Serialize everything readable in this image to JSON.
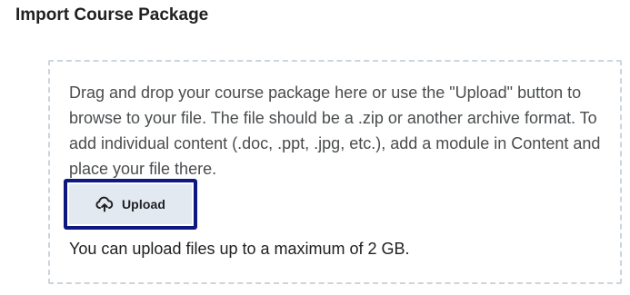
{
  "header": {
    "title": "Import Course Package"
  },
  "dropzone": {
    "instructions": "Drag and drop your course package here or use the \"Upload\" button to browse to your file. The file should be a .zip or another archive format. To add individual content (.doc, .ppt, .jpg, etc.), add a module in Content and place your file there.",
    "upload_button": {
      "label": "Upload",
      "icon": "cloud-upload-icon"
    },
    "limit_text": "You can upload files up to a maximum of 2 GB."
  },
  "colors": {
    "focus_border": "#0d1880",
    "button_bg": "#e3e9f1",
    "dashed_border": "#cdd5dc"
  }
}
